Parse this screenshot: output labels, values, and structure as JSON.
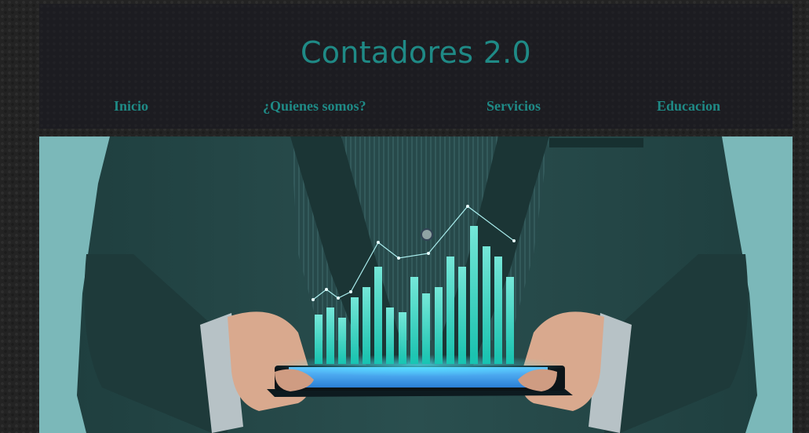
{
  "header": {
    "title": "Contadores 2.0"
  },
  "nav": {
    "items": [
      {
        "label": "Inicio"
      },
      {
        "label": "¿Quienes somos?"
      },
      {
        "label": "Servicios"
      },
      {
        "label": "Educacion"
      }
    ]
  },
  "theme": {
    "accent": "#1f8a86",
    "page_background": "#232323",
    "header_background": "#1c1c21",
    "hero_background": "#7bb8b9"
  },
  "hero": {
    "icon": "businessman-holding-tablet-with-bar-chart-image"
  }
}
